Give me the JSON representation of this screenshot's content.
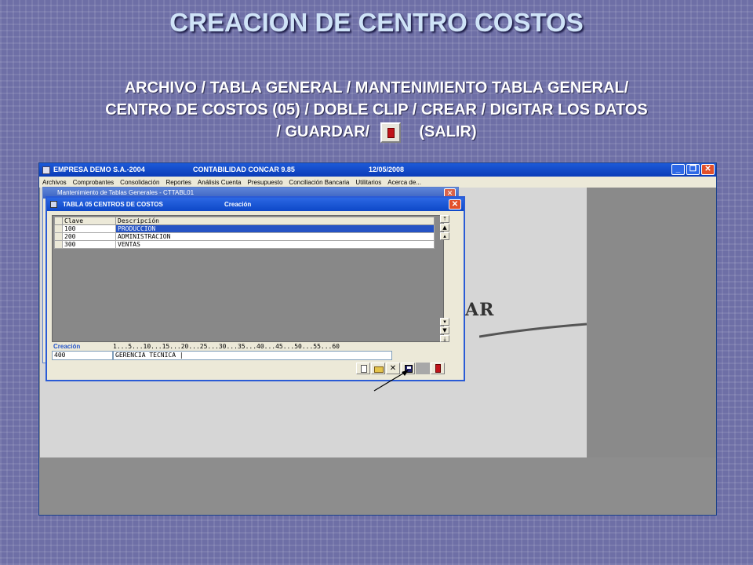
{
  "slide": {
    "title": "CREACION DE CENTRO COSTOS",
    "instruction_line1": "ARCHIVO / TABLA GENERAL / MANTENIMIENTO TABLA GENERAL/",
    "instruction_line2": "CENTRO DE COSTOS (05) / DOBLE CLIP / CREAR / DIGITAR LOS DATOS",
    "instruction_line3_a": "/ GUARDAR/",
    "instruction_line3_b": "(SALIR)"
  },
  "app": {
    "title_company": "EMPRESA DEMO S.A.-2004",
    "title_product": "CONTABILIDAD CONCAR 9.85",
    "title_date": "12/05/2008",
    "menu": [
      "Archivos",
      "Comprobantes",
      "Consolidación",
      "Reportes",
      "Análisis Cuenta",
      "Presupuesto",
      "Conciliación Bancaria",
      "Utilitarios",
      "Acerca de..."
    ],
    "logo_fragment": "AR"
  },
  "maint_window": {
    "title": "Mantenimiento de Tablas Generales - CTTABL01"
  },
  "tabla_window": {
    "title": "TABLA 05 CENTROS DE COSTOS",
    "mode": "Creación",
    "columns": [
      "Clave",
      "Descripción"
    ],
    "rows": [
      {
        "clave": "100",
        "descripcion": "PRODUCCION",
        "selected": true
      },
      {
        "clave": "200",
        "descripcion": "ADMINISTRACION",
        "selected": false
      },
      {
        "clave": "300",
        "descripcion": "VENTAS",
        "selected": false
      }
    ],
    "section_label": "Creación",
    "ruler": "1...5...10...15...20...25...30...35...40...45...50...55...60",
    "input_clave": "400",
    "input_descripcion": "GERENCIA TECNICA |"
  },
  "icons": {
    "toolbar": [
      "new-icon",
      "open-icon",
      "delete-icon",
      "save-icon",
      "exit-icon"
    ]
  }
}
